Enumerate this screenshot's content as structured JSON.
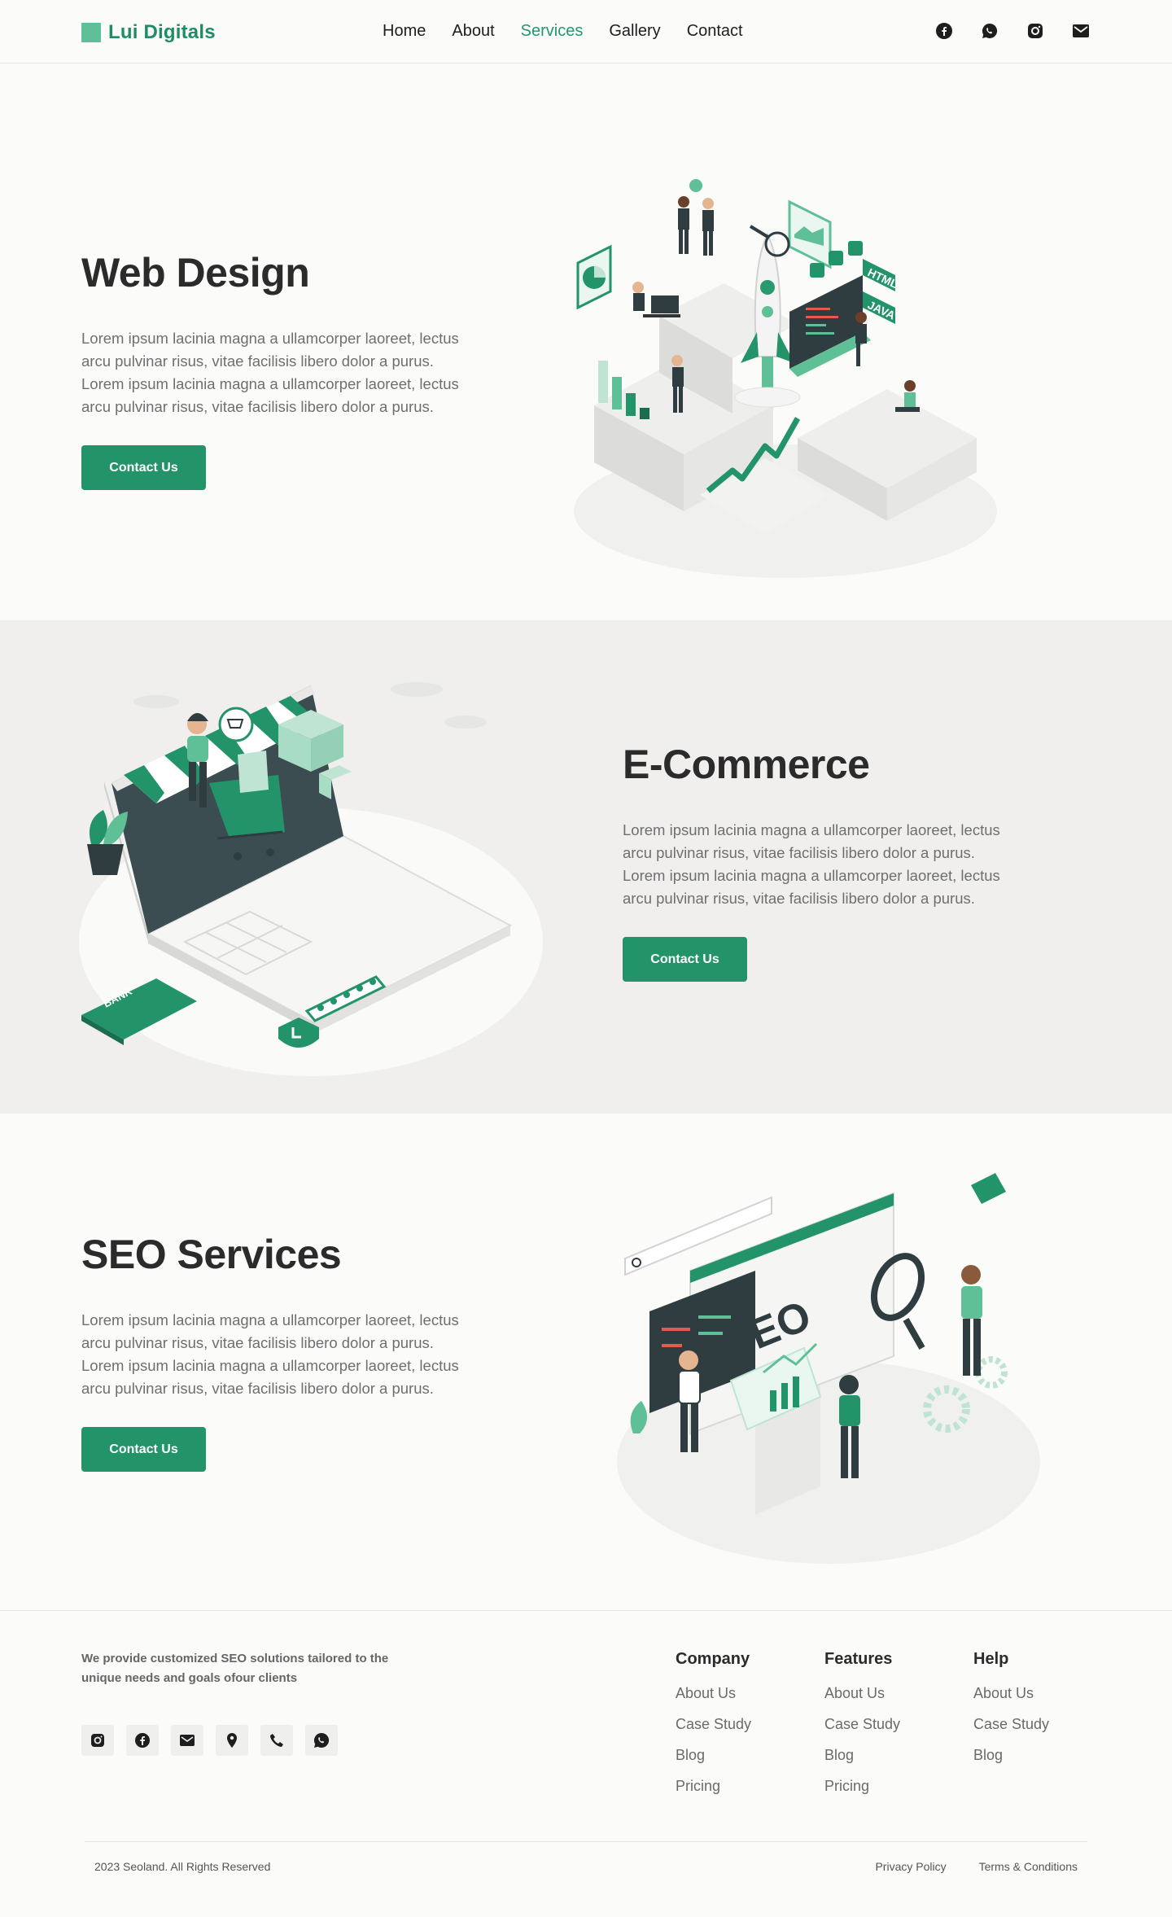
{
  "brand": {
    "name": "Lui Digitals",
    "accent": "#23946a",
    "logo_color": "#5fbf96"
  },
  "nav": {
    "items": [
      {
        "label": "Home",
        "active": false
      },
      {
        "label": "About",
        "active": false
      },
      {
        "label": "Services",
        "active": true
      },
      {
        "label": "Gallery",
        "active": false
      },
      {
        "label": "Contact",
        "active": false
      }
    ]
  },
  "header_social": [
    "facebook-icon",
    "whatsapp-icon",
    "instagram-icon",
    "email-icon"
  ],
  "sections": [
    {
      "title": "Web Design",
      "body": "Lorem ipsum lacinia magna a ullamcorper laoreet, lectus arcu pulvinar risus, vitae facilisis libero dolor a purus. Lorem ipsum lacinia magna a ullamcorper laoreet, lectus arcu pulvinar risus, vitae facilisis libero dolor a purus.",
      "button": "Contact Us",
      "illustration": "web-design-illustration"
    },
    {
      "title": "E-Commerce",
      "body": "Lorem ipsum lacinia magna a ullamcorper laoreet, lectus arcu pulvinar risus, vitae facilisis libero dolor a purus. Lorem ipsum lacinia magna a ullamcorper laoreet, lectus arcu pulvinar risus, vitae facilisis libero dolor a purus.",
      "button": "Contact Us",
      "illustration": "ecommerce-illustration",
      "illustration_text": {
        "card": "BANK"
      }
    },
    {
      "title": "SEO Services",
      "body": "Lorem ipsum lacinia magna a ullamcorper laoreet, lectus arcu pulvinar risus, vitae facilisis libero dolor a purus. Lorem ipsum lacinia magna a ullamcorper laoreet, lectus arcu pulvinar risus, vitae facilisis libero dolor a purus.",
      "button": "Contact Us",
      "illustration": "seo-illustration",
      "illustration_text": {
        "sign": "SEO"
      }
    }
  ],
  "illustration_labels": {
    "html": "HTML",
    "java": "JAVA"
  },
  "footer": {
    "tagline": "We provide customized SEO solutions tailored to the unique needs and goals ofour clients",
    "social": [
      "instagram-icon",
      "facebook-icon",
      "email-icon",
      "location-icon",
      "phone-icon",
      "whatsapp-icon"
    ],
    "columns": [
      {
        "heading": "Company",
        "links": [
          "About Us",
          "Case Study",
          "Blog",
          "Pricing"
        ]
      },
      {
        "heading": "Features",
        "links": [
          "About Us",
          "Case Study",
          "Blog",
          "Pricing"
        ]
      },
      {
        "heading": "Help",
        "links": [
          "About Us",
          "Case Study",
          "Blog"
        ]
      }
    ],
    "copyright": "2023 Seoland. All Rights Reserved",
    "legal": [
      "Privacy Policy",
      "Terms & Conditions"
    ]
  }
}
